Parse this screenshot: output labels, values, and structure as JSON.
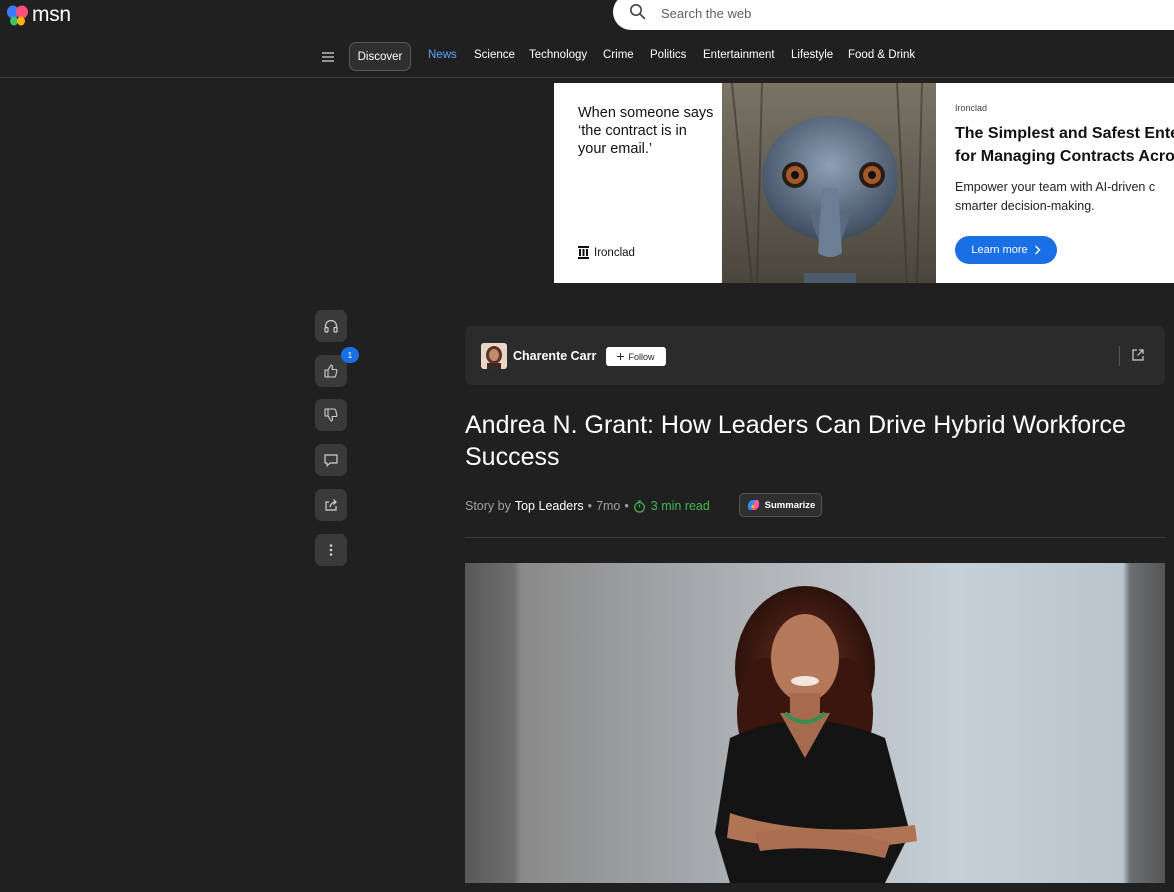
{
  "header": {
    "logo_text": "msn",
    "search_placeholder": "Search the web"
  },
  "nav": {
    "discover_label": "Discover",
    "items": [
      "News",
      "Science",
      "Technology",
      "Crime",
      "Politics",
      "Entertainment",
      "Lifestyle",
      "Food & Drink"
    ],
    "active_item": "News"
  },
  "ad": {
    "tagline": "When someone says ‘the contract is in your email.’",
    "brand_logo_text": "Ironclad",
    "sponsor": "Ironclad",
    "headline_line1": "The Simplest and Safest Ente",
    "headline_line2": "for Managing Contracts Acro",
    "body_line1": "Empower your team with AI-driven c",
    "body_line2": "smarter decision-making.",
    "cta_label": "Learn more",
    "cta_color": "#1a6fe5"
  },
  "rail": {
    "buttons": [
      "headphones-icon",
      "thumbs-up-icon",
      "thumbs-down-icon",
      "comment-icon",
      "share-icon",
      "more-icon"
    ],
    "like_count": "1"
  },
  "author_card": {
    "name": "Charente Carr",
    "follow_label": "Follow"
  },
  "article": {
    "title": "Andrea N. Grant: How Leaders Can Drive Hybrid Workforce Success",
    "story_by_prefix": "Story by",
    "publisher": "Top Leaders",
    "age": "7mo",
    "read_time": "3 min read",
    "summarize_label": "Summarize"
  },
  "colors": {
    "background": "#202020",
    "accent_blue": "#5ea2ff",
    "read_time_green": "#3fb950"
  }
}
